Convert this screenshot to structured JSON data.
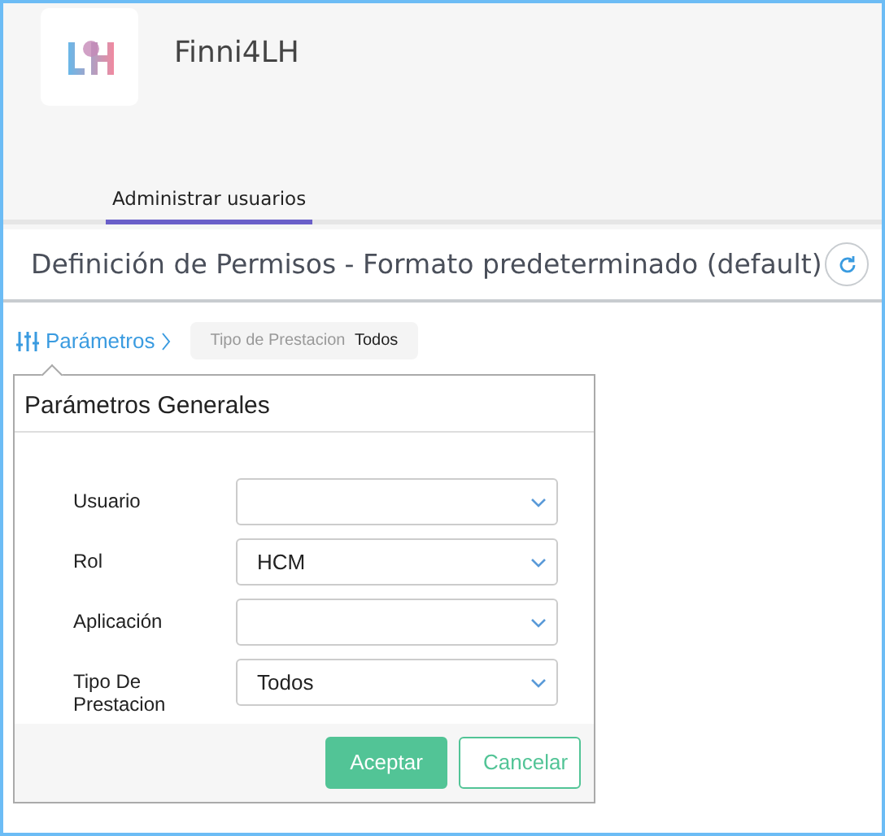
{
  "app": {
    "name": "Finni4LH"
  },
  "tabs": [
    {
      "label": "Administrar usuarios",
      "selected": true
    }
  ],
  "page": {
    "title": "Definición de Permisos - Formato predeterminado (default)"
  },
  "filter_bar": {
    "toggle_label": "Parámetros",
    "chips": [
      {
        "label": "Tipo de Prestacion",
        "value": "Todos"
      }
    ]
  },
  "popup": {
    "title": "Parámetros Generales",
    "fields": [
      {
        "label": "Usuario"
      },
      {
        "label": "Rol",
        "value": "HCM"
      },
      {
        "label": "Aplicación"
      },
      {
        "label": "Tipo De Prestacion",
        "value": "Todos"
      }
    ],
    "buttons": [
      {
        "label": "Aceptar",
        "kind": "primary"
      },
      {
        "label": "Cancelar",
        "kind": "secondary"
      }
    ]
  }
}
